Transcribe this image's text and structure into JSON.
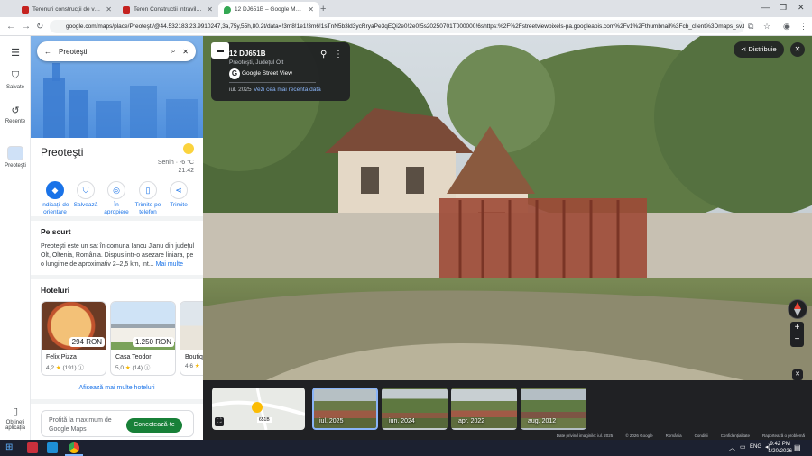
{
  "browser": {
    "tabs": [
      {
        "title": "Terenuri construcții de vânzare",
        "icon": "imobiliare-icon",
        "color": "#c5221f"
      },
      {
        "title": "Teren Constructii intravilan de",
        "icon": "imobiliare-icon",
        "color": "#c5221f"
      },
      {
        "title": "12 DJ651B – Google Maps",
        "icon": "maps-pin-icon",
        "color": "#34a853"
      }
    ],
    "url": "google.com/maps/place/Preoteşti/@44.532183,23.9910247,3a,75y,55h,80.2t/data=!3m8!1e1!3m6!1sTnN5b3ld3ycRryaPe3qEQi2e0!2e0!5s20250701T000000!6shttps:%2F%2Fstreetviewpixels-pa.googleapis.com%2Fv1%2Fthumbnail%3Fcb_client%3Dmaps_sv.tactile..."
  },
  "rail": {
    "saved": "Salvate",
    "recent": "Recente",
    "current": "Preoteşti",
    "apps": "Obțineți aplicația"
  },
  "search": {
    "query": "Preoteşti"
  },
  "place": {
    "name": "Preoteşti",
    "weather": "Senin · -6 °C",
    "time": "21:42"
  },
  "actions": [
    {
      "label": "Indicații de orientare",
      "icon": "directions-icon"
    },
    {
      "label": "Salvează",
      "icon": "bookmark-icon"
    },
    {
      "label": "În apropiere",
      "icon": "nearby-icon"
    },
    {
      "label": "Trimite pe telefon",
      "icon": "phone-icon"
    },
    {
      "label": "Trimite",
      "icon": "share-icon"
    }
  ],
  "about": {
    "heading": "Pe scurt",
    "text": "Preoteşti este un sat în comuna Iancu Jianu din județul Olt, Oltenia, România. Dispus intr-o asezare liniara, pe o lungime de aproximativ 2–2,5 km, int...",
    "more": "Mai multe"
  },
  "hotels": {
    "heading": "Hoteluri",
    "items": [
      {
        "name": "Felix Pizza",
        "rating": "4,2",
        "reviews": "(191)",
        "price": "294 RON"
      },
      {
        "name": "Casa Teodor",
        "rating": "5,0",
        "reviews": "(14)",
        "price": "1.250 RON"
      },
      {
        "name": "Boutiq",
        "rating": "4,6",
        "reviews": "",
        "price": ""
      }
    ],
    "more": "Afișează mai multe hoteluri"
  },
  "promo": {
    "text": "Profită la maximum de Google Maps",
    "button": "Conectează-te"
  },
  "streetview": {
    "road": "12 DJ651B",
    "locality": "Preoteşti, Județul Olt",
    "provider": "Google Street View",
    "date": "iul. 2025",
    "newer": "Vezi cea mai recentă dată",
    "share": "Distribuie"
  },
  "timeline": [
    {
      "label": "iul. 2025",
      "selected": true
    },
    {
      "label": "iun. 2024",
      "selected": false
    },
    {
      "label": "apr. 2022",
      "selected": false
    },
    {
      "label": "aug. 2012",
      "selected": false
    }
  ],
  "minimap_label": "651B",
  "footer": [
    "Date privind imaginile: iul. 2025",
    "© 2026 Google",
    "România",
    "Condiții",
    "Confidențialitate",
    "Raportează o problemă"
  ],
  "taskbar": {
    "lang": "ENG",
    "time": "9:42 PM",
    "date": "1/20/2026"
  }
}
